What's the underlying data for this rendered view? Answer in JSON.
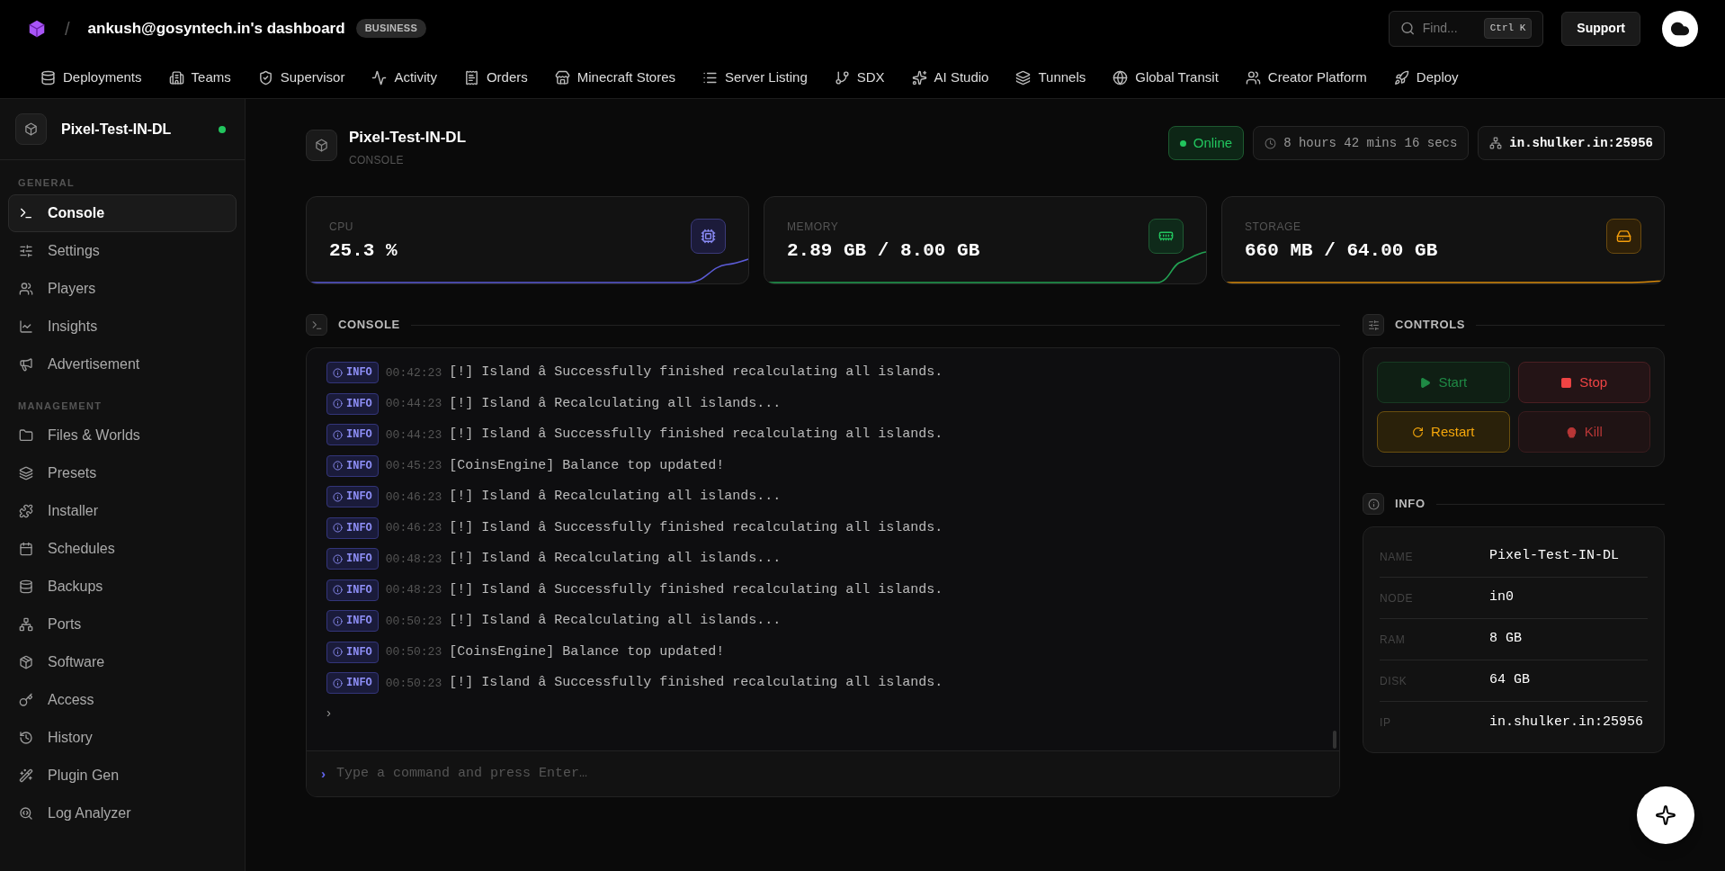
{
  "brand": {
    "workspace": "ankush@gosyntech.in's dashboard",
    "plan": "BUSINESS",
    "separator": "/"
  },
  "search": {
    "placeholder": "Find...",
    "shortcut": "Ctrl K"
  },
  "support": "Support",
  "nav": [
    {
      "label": "Deployments"
    },
    {
      "label": "Teams"
    },
    {
      "label": "Supervisor"
    },
    {
      "label": "Activity"
    },
    {
      "label": "Orders"
    },
    {
      "label": "Minecraft Stores"
    },
    {
      "label": "Server Listing"
    },
    {
      "label": "SDX"
    },
    {
      "label": "AI Studio"
    },
    {
      "label": "Tunnels"
    },
    {
      "label": "Global Transit"
    },
    {
      "label": "Creator Platform"
    },
    {
      "label": "Deploy"
    }
  ],
  "server": {
    "name": "Pixel-Test-IN-DL",
    "online": true
  },
  "sidebar": {
    "sections": [
      {
        "title": "GENERAL",
        "items": [
          {
            "label": "Console",
            "selected": true
          },
          {
            "label": "Settings",
            "selected": false
          },
          {
            "label": "Players",
            "selected": false
          },
          {
            "label": "Insights",
            "selected": false
          },
          {
            "label": "Advertisement",
            "selected": false
          }
        ]
      },
      {
        "title": "MANAGEMENT",
        "items": [
          {
            "label": "Files & Worlds",
            "selected": false
          },
          {
            "label": "Presets",
            "selected": false
          },
          {
            "label": "Installer",
            "selected": false
          },
          {
            "label": "Schedules",
            "selected": false
          },
          {
            "label": "Backups",
            "selected": false
          },
          {
            "label": "Ports",
            "selected": false
          },
          {
            "label": "Software",
            "selected": false
          },
          {
            "label": "Access",
            "selected": false
          },
          {
            "label": "History",
            "selected": false
          },
          {
            "label": "Plugin Gen",
            "selected": false
          },
          {
            "label": "Log Analyzer",
            "selected": false
          }
        ]
      }
    ]
  },
  "header": {
    "title": "Pixel-Test-IN-DL",
    "subtitle": "CONSOLE",
    "status": "Online",
    "online": true,
    "uptime": "8 hours 42 mins 16 secs",
    "address": "in.shulker.in:25956"
  },
  "stats": [
    {
      "kind": "cpu",
      "label": "CPU",
      "value": "25.3 %"
    },
    {
      "kind": "memory",
      "label": "MEMORY",
      "value": "2.89 GB / 8.00 GB"
    },
    {
      "kind": "storage",
      "label": "STORAGE",
      "value": "660 MB / 64.00 GB"
    }
  ],
  "console": {
    "title": "CONSOLE",
    "lines": [
      {
        "level": "INFO",
        "time": "00:42:23",
        "message": "[!] Island â Successfully finished recalculating all islands."
      },
      {
        "level": "INFO",
        "time": "00:44:23",
        "message": "[!] Island â Recalculating all islands..."
      },
      {
        "level": "INFO",
        "time": "00:44:23",
        "message": "[!] Island â Successfully finished recalculating all islands."
      },
      {
        "level": "INFO",
        "time": "00:45:23",
        "message": "[CoinsEngine] Balance top updated!"
      },
      {
        "level": "INFO",
        "time": "00:46:23",
        "message": "[!] Island â Recalculating all islands..."
      },
      {
        "level": "INFO",
        "time": "00:46:23",
        "message": "[!] Island â Successfully finished recalculating all islands."
      },
      {
        "level": "INFO",
        "time": "00:48:23",
        "message": "[!] Island â Recalculating all islands..."
      },
      {
        "level": "INFO",
        "time": "00:48:23",
        "message": "[!] Island â Successfully finished recalculating all islands."
      },
      {
        "level": "INFO",
        "time": "00:50:23",
        "message": "[!] Island â Recalculating all islands..."
      },
      {
        "level": "INFO",
        "time": "00:50:23",
        "message": "[CoinsEngine] Balance top updated!"
      },
      {
        "level": "INFO",
        "time": "00:50:23",
        "message": "[!] Island â Successfully finished recalculating all islands."
      }
    ],
    "caret": "›",
    "input_prompt": "›",
    "placeholder": "Type a command and press Enter…"
  },
  "controls": {
    "title": "CONTROLS",
    "buttons": [
      {
        "kind": "start",
        "label": "Start"
      },
      {
        "kind": "stop",
        "label": "Stop"
      },
      {
        "kind": "restart",
        "label": "Restart"
      },
      {
        "kind": "kill",
        "label": "Kill"
      }
    ]
  },
  "info": {
    "title": "INFO",
    "rows": [
      {
        "label": "NAME",
        "value": "Pixel-Test-IN-DL"
      },
      {
        "label": "NODE",
        "value": "in0"
      },
      {
        "label": "RAM",
        "value": "8 GB"
      },
      {
        "label": "DISK",
        "value": "64 GB"
      },
      {
        "label": "IP",
        "value": "in.shulker.in:25956"
      }
    ]
  }
}
